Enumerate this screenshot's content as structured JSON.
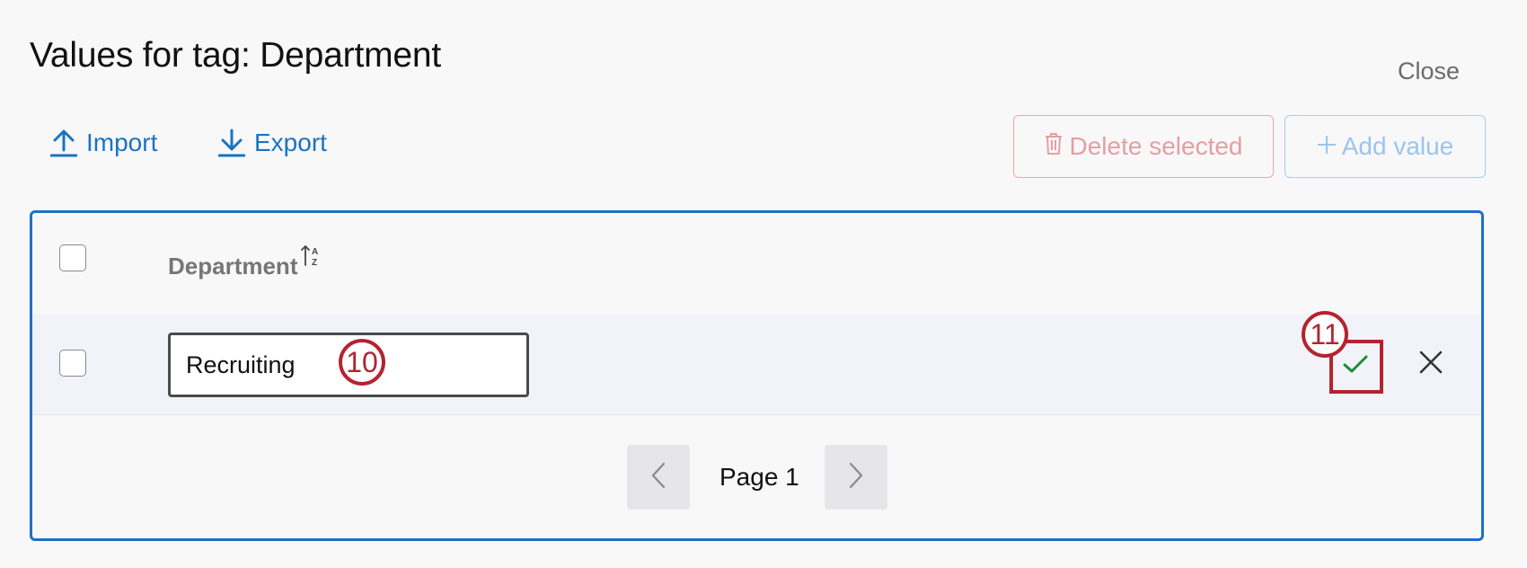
{
  "header": {
    "title": "Values for tag: Department",
    "close_label": "Close"
  },
  "toolbar": {
    "import_label": "Import",
    "export_label": "Export",
    "delete_selected_label": "Delete selected",
    "add_value_label": "Add value"
  },
  "table": {
    "column_header": "Department",
    "sort_icon": "sort-alpha-icon",
    "rows": [
      {
        "value": "Recruiting",
        "editing": true
      }
    ]
  },
  "pagination": {
    "page_label": "Page 1"
  },
  "annotations": {
    "step_a": "10",
    "step_b": "11"
  },
  "colors": {
    "accent": "#1f6fc4",
    "link": "#1a73c2",
    "delete_disabled": "#e59ea2",
    "add_disabled": "#9cc4ec",
    "confirm_check": "#1e8a3e",
    "annotation": "#b4232f"
  }
}
